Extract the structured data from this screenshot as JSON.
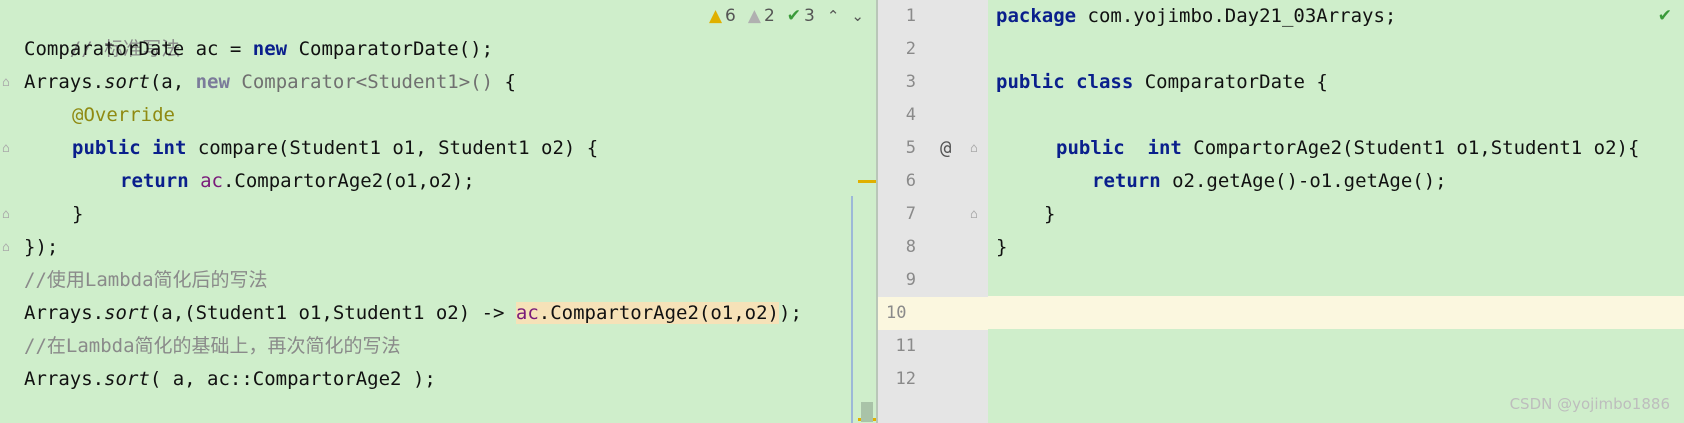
{
  "left_editor": {
    "inspection": {
      "warnings_count": "6",
      "weak_warnings_count": "2",
      "typos_count": "3"
    },
    "lines": {
      "l1": "// 标准写法",
      "l2_type": "ComparatorDate",
      "l2_var": " ac = ",
      "l2_new": "new",
      "l2_ctor": " ComparatorDate();",
      "l3_a": "Arrays.",
      "l3_sort": "sort",
      "l3_b": "(a, ",
      "l3_new": "new",
      "l3_c": " Comparator<Student1>()",
      "l3_d": " {",
      "l4": "@Override",
      "l5_public": "public",
      "l5_int": "int",
      "l5_rest": " compare(Student1 o1, Student1 o2) {",
      "l6_return": "return",
      "l6_ac": "ac",
      "l6_rest": ".CompartorAge2(o1,o2);",
      "l7": "}",
      "l8": "});",
      "l9": "//使用Lambda简化后的写法",
      "l10_a": "Arrays.",
      "l10_sort": "sort",
      "l10_b": "(a,(Student1 o1,Student1 o2) -> ",
      "l10_ac": "ac",
      "l10_call": ".CompartorAge2(o1,o2)",
      "l10_end": ");",
      "l11": "//在Lambda简化的基础上，再次简化的写法",
      "l12_a": "Arrays.",
      "l12_sort": "sort",
      "l12_b": "( a, ac::CompartorAge2 );"
    }
  },
  "right_editor": {
    "line_numbers": [
      "1",
      "2",
      "3",
      "4",
      "5",
      "6",
      "7",
      "8",
      "9",
      "10",
      "11",
      "12"
    ],
    "override_marker": "@",
    "lines": {
      "r1_kw": "package",
      "r1_rest": " com.yojimbo.Day21_03Arrays;",
      "r3_public": "public",
      "r3_class": "class",
      "r3_rest": " ComparatorDate {",
      "r5_public": "public",
      "r5_int": "int",
      "r5_rest": " CompartorAge2(Student1 o1,Student1 o2){",
      "r6_return": "return",
      "r6_rest": " o2.getAge()-o1.getAge();",
      "r7": "}",
      "r8": "}"
    }
  },
  "watermark": "CSDN @yojimbo1886"
}
